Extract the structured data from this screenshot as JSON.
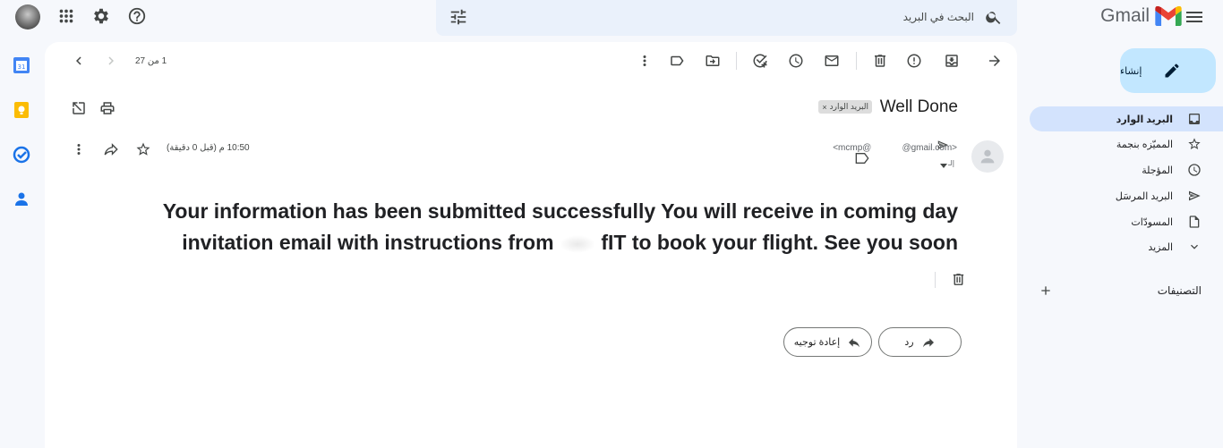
{
  "app": {
    "name": "Gmail",
    "brand_colors": {
      "red": "#ea4335",
      "blue": "#4285f4",
      "green": "#34a853",
      "yellow": "#fbbc04"
    }
  },
  "search": {
    "placeholder": "البحث في البريد"
  },
  "header_icons": [
    "tune-icon",
    "help-icon",
    "settings-icon",
    "apps-icon",
    "avatar"
  ],
  "sidebar": {
    "compose_label": "إنشاء",
    "items": [
      {
        "label": "البريد الوارد",
        "icon": "inbox-icon",
        "active": true
      },
      {
        "label": "المميّزه بنجمة",
        "icon": "star-icon",
        "active": false
      },
      {
        "label": "المؤجلة",
        "icon": "clock-icon",
        "active": false
      },
      {
        "label": "البريد المرسَل",
        "icon": "send-icon",
        "active": false
      },
      {
        "label": "المسودّات",
        "icon": "draft-icon",
        "active": false
      },
      {
        "label": "المزيد",
        "icon": "chevron-down-icon",
        "active": false
      }
    ],
    "labels_title": "التصنيفات"
  },
  "rail_apps": [
    "calendar-icon",
    "keep-icon",
    "tasks-icon",
    "contacts-icon"
  ],
  "toolbar": {
    "pager": "1 من 27"
  },
  "email": {
    "subject": "Well Done",
    "label_chip": "البريد الوارد",
    "sender_email_start": "<mcmp@",
    "sender_email_end": "@gmail.com>",
    "to_line": "إلـ",
    "timestamp": "10:50 م (قبل 0 دقيقة)",
    "body_line1": "Your information has been submitted successfully You will receive in coming day",
    "body_line2_start": "invitation email with instructions from",
    "body_line2_end": "fIT to book your flight. See you soon"
  },
  "actions": {
    "reply_label": "رد",
    "forward_label": "إعادة توجيه"
  }
}
